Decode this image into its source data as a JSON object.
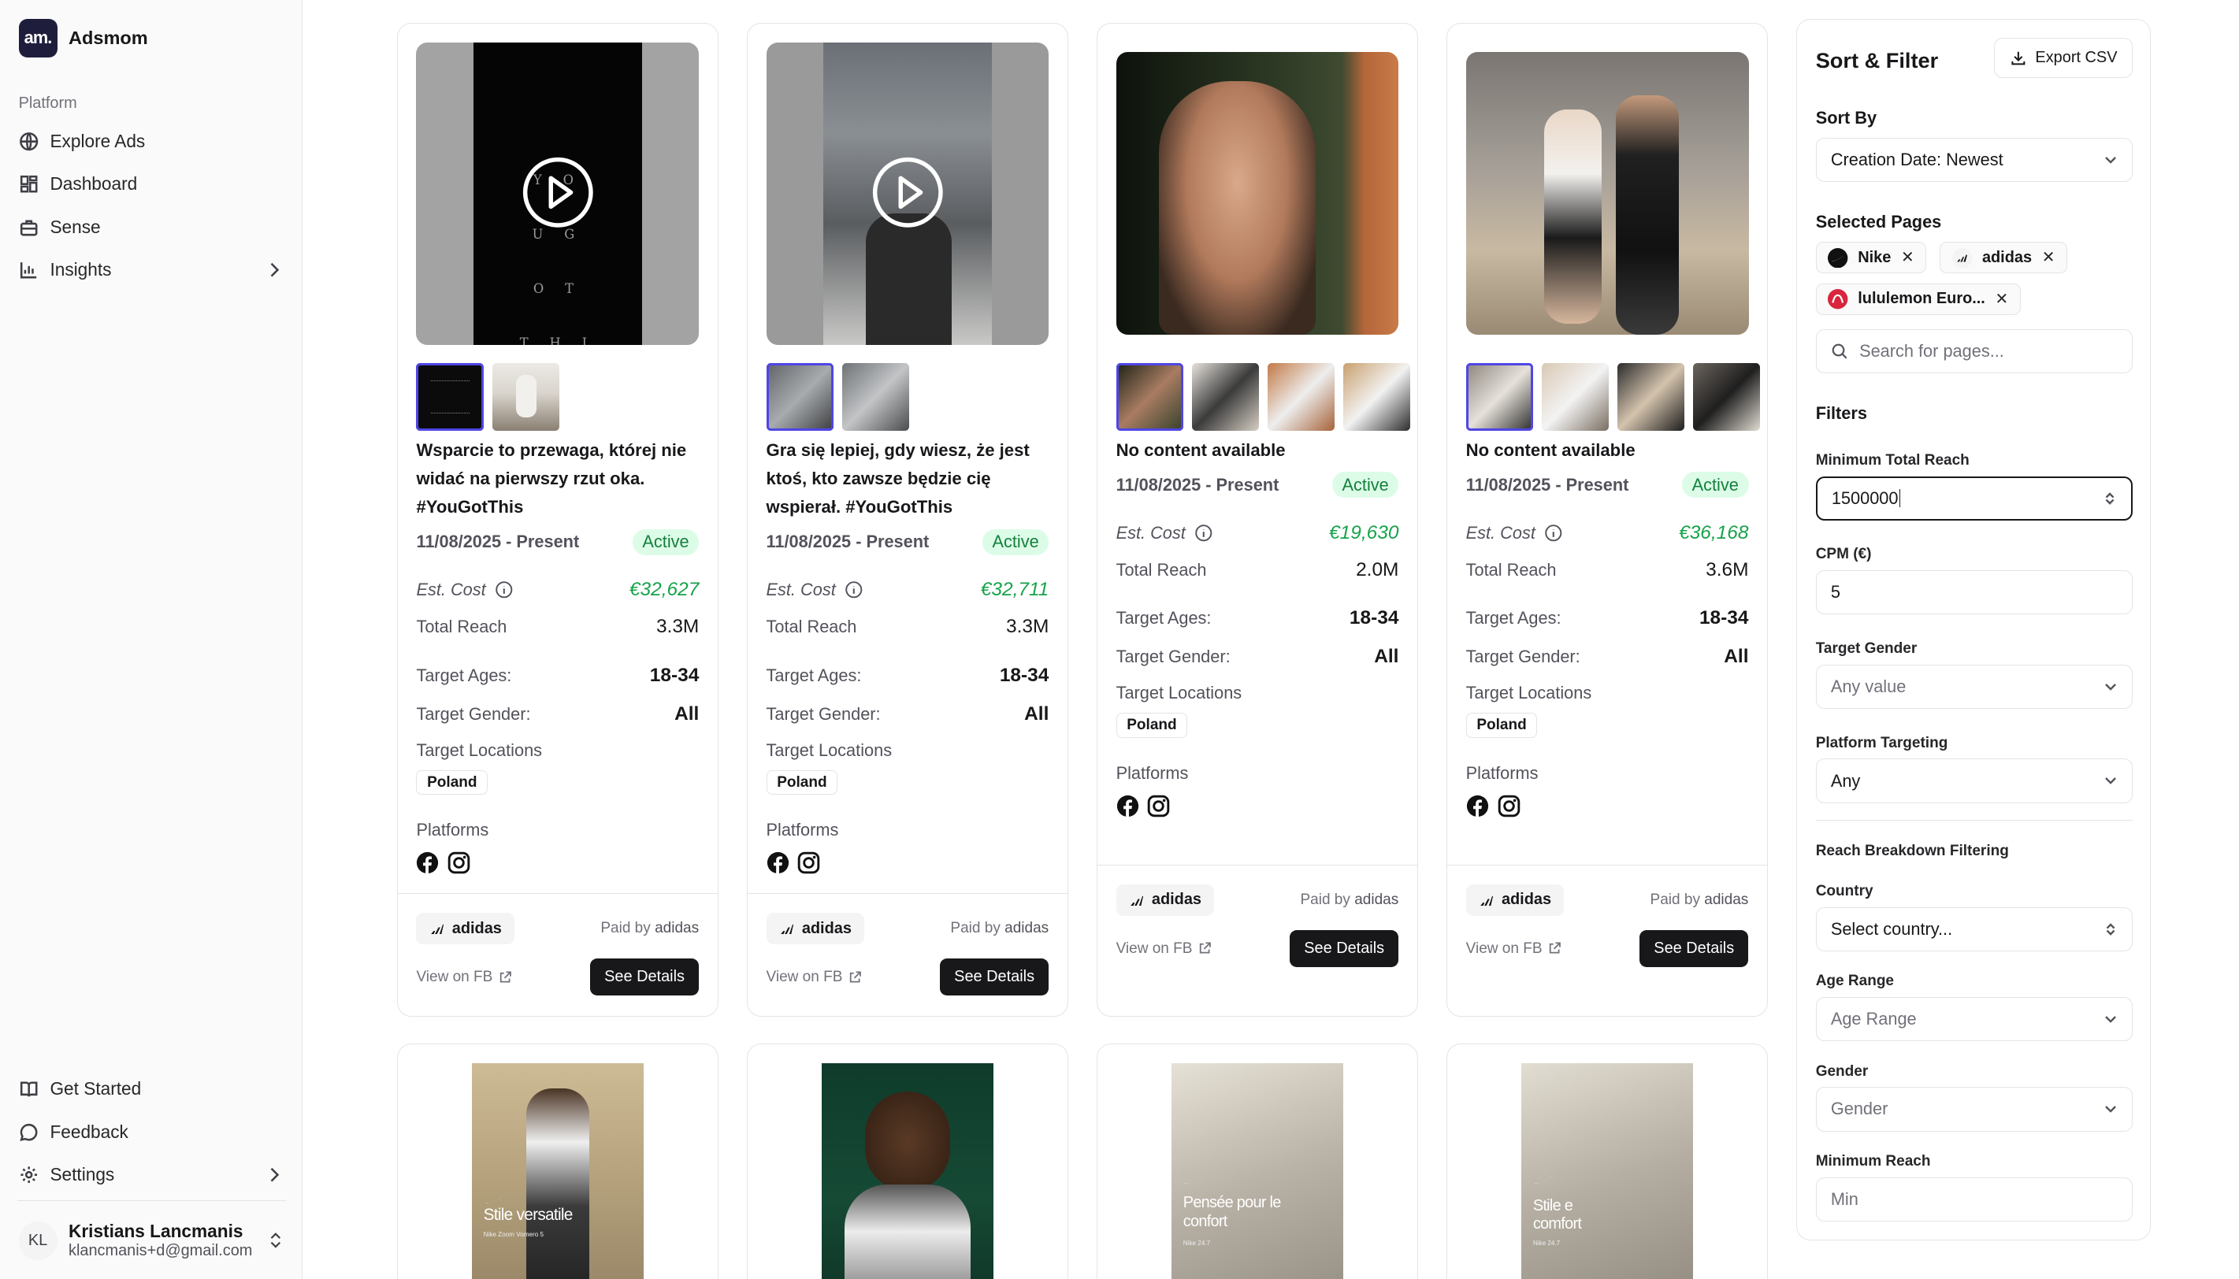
{
  "app": {
    "name": "Adsmom",
    "logo_text": "am."
  },
  "sidebar": {
    "group_label": "Platform",
    "items": [
      {
        "label": "Explore Ads",
        "icon": "globe-icon"
      },
      {
        "label": "Dashboard",
        "icon": "dashboard-icon"
      },
      {
        "label": "Sense",
        "icon": "briefcase-icon"
      },
      {
        "label": "Insights",
        "icon": "bar-chart-icon"
      }
    ],
    "bottom_items": [
      {
        "label": "Get Started",
        "icon": "book-icon"
      },
      {
        "label": "Feedback",
        "icon": "message-icon"
      },
      {
        "label": "Settings",
        "icon": "gear-icon"
      }
    ],
    "user": {
      "initials": "KL",
      "name": "Kristians Lancmanis",
      "email": "klancmanis+d@gmail.com"
    }
  },
  "labels": {
    "est_cost": "Est. Cost",
    "total_reach": "Total Reach",
    "target_ages": "Target Ages:",
    "target_gender": "Target Gender:",
    "target_locations": "Target Locations",
    "platforms": "Platforms",
    "paid_by": "Paid by",
    "view_on_fb": "View on FB",
    "see_details": "See Details"
  },
  "cards": [
    {
      "title": "Wsparcie to przewaga, której nie widać na pierwszy rzut oka. #YouGotThis",
      "date": "11/08/2025 - Present",
      "status": "Active",
      "est_cost": "€32,627",
      "total_reach": "3.3M",
      "ages": "18-34",
      "gender": "All",
      "location": "Poland",
      "advertiser": "adidas",
      "paid_by": "adidas",
      "video_text": "Y O U G O T T H I S"
    },
    {
      "title": "Gra się lepiej, gdy wiesz, że jest ktoś, kto zawsze będzie cię wspierał. #YouGotThis",
      "date": "11/08/2025 - Present",
      "status": "Active",
      "est_cost": "€32,711",
      "total_reach": "3.3M",
      "ages": "18-34",
      "gender": "All",
      "location": "Poland",
      "advertiser": "adidas",
      "paid_by": "adidas"
    },
    {
      "title": "No content available",
      "date": "11/08/2025 - Present",
      "status": "Active",
      "est_cost": "€19,630",
      "total_reach": "2.0M",
      "ages": "18-34",
      "gender": "All",
      "location": "Poland",
      "advertiser": "adidas",
      "paid_by": "adidas"
    },
    {
      "title": "No content available",
      "date": "11/08/2025 - Present",
      "status": "Active",
      "est_cost": "€36,168",
      "total_reach": "3.6M",
      "ages": "18-34",
      "gender": "All",
      "location": "Poland",
      "advertiser": "adidas",
      "paid_by": "adidas"
    }
  ],
  "bottom_cards": [
    {
      "overlay": "Stile versatile",
      "sub": "Nike Zoom Vomero 5"
    },
    {
      "overlay": "",
      "sub": ""
    },
    {
      "overlay": "Pensée pour le confort",
      "sub": "Nike 24.7"
    },
    {
      "overlay": "Stile e comfort",
      "sub": "Nike 24.7"
    }
  ],
  "filters": {
    "title": "Sort & Filter",
    "export_label": "Export CSV",
    "sort_by_label": "Sort By",
    "sort_by_value": "Creation Date: Newest",
    "selected_pages_label": "Selected Pages",
    "pages": [
      "Nike",
      "adidas",
      "lululemon Euro..."
    ],
    "search_placeholder": "Search for pages...",
    "filters_label": "Filters",
    "min_reach_label": "Minimum Total Reach",
    "min_reach_value": "1500000",
    "cpm_label": "CPM (€)",
    "cpm_value": "5",
    "target_gender_label": "Target Gender",
    "target_gender_value": "Any value",
    "platform_label": "Platform Targeting",
    "platform_value": "Any",
    "breakdown_label": "Reach Breakdown Filtering",
    "country_label": "Country",
    "country_value": "Select country...",
    "age_range_label": "Age Range",
    "age_range_value": "Age Range",
    "gender_label": "Gender",
    "gender_value": "Gender",
    "min_reach2_label": "Minimum Reach",
    "min_reach2_placeholder": "Min"
  },
  "colors": {
    "accent": "#4f46e5",
    "active_bg": "#dcfce7",
    "active_text": "#15803d",
    "cost": "#16a34a"
  }
}
